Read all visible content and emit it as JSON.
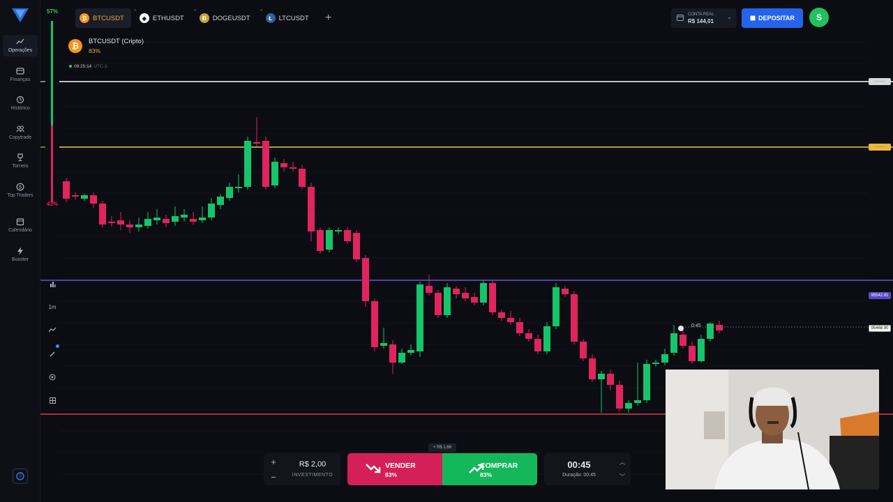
{
  "nav": {
    "items": [
      {
        "label": "Operações",
        "icon": "chart-line-icon"
      },
      {
        "label": "Finanças",
        "icon": "wallet-icon"
      },
      {
        "label": "Histórico",
        "icon": "history-icon"
      },
      {
        "label": "Copytrade",
        "icon": "users-icon"
      },
      {
        "label": "Torneio",
        "icon": "trophy-icon"
      },
      {
        "label": "Top Traders",
        "icon": "dollar-coin-icon"
      },
      {
        "label": "Calendário",
        "icon": "calendar-icon"
      },
      {
        "label": "Booster",
        "icon": "lightning-icon"
      }
    ]
  },
  "sentiment": {
    "up": "57%",
    "down": "43%"
  },
  "tabs": [
    {
      "label": "BTCUSDT",
      "coin": "₿",
      "color": "#f7931a"
    },
    {
      "label": "ETHUSDT",
      "coin": "◆",
      "color": "#ffffff"
    },
    {
      "label": "DOGEUSDT",
      "coin": "Ð",
      "color": "#c2a633"
    },
    {
      "label": "LTCUSDT",
      "coin": "Ł",
      "color": "#345d9d"
    }
  ],
  "account": {
    "label": "CONTA REAL",
    "balance": "R$ 144,01"
  },
  "deposit_label": "DEPOSITAR",
  "avatar_letter": "S",
  "asset": {
    "name": "BTCUSDT (Cripto)",
    "payout": "83%"
  },
  "clock": {
    "time": "09:25:14",
    "tz": "UTC-3"
  },
  "timeframe": "1m",
  "price_labels": {
    "blue": "95542.81",
    "current": "95468.90"
  },
  "countdown_marker": "0:45",
  "investment": {
    "amount": "R$ 2,00",
    "label": "INVESTIMENTO"
  },
  "sell": {
    "label": "VENDER",
    "payout": "83%"
  },
  "buy": {
    "label": "COMPRAR",
    "payout": "83%"
  },
  "profit_tip": "+ R$ 1,66",
  "duration": {
    "time": "00:45",
    "label": "Duração: 00:45"
  },
  "colors": {
    "up": "#16c46a",
    "down": "#e0245e",
    "accent": "#2563eb"
  }
}
